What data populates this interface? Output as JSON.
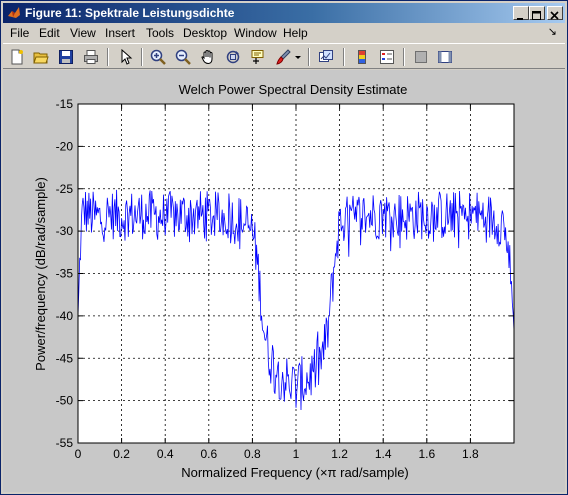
{
  "window": {
    "title": "Figure 11: Spektrale Leistungsdichte",
    "controls": [
      "minimize",
      "maximize",
      "close"
    ]
  },
  "menu": {
    "items": [
      "File",
      "Edit",
      "View",
      "Insert",
      "Tools",
      "Desktop",
      "Window",
      "Help"
    ],
    "dock_arrow": "↘"
  },
  "toolbar": {
    "buttons": [
      "new-figure",
      "open-file",
      "save",
      "print",
      "edit-plot",
      "zoom-in",
      "zoom-out",
      "pan",
      "rotate-3d",
      "data-cursor",
      "brush",
      "link-plot",
      "insert-colorbar",
      "insert-legend",
      "hide-plot-tools",
      "show-plot-tools"
    ]
  },
  "colors": {
    "line": "#0000ff",
    "plot_background": "#ffffff",
    "figure_background": "#c8c8c8"
  },
  "chart_data": {
    "type": "line",
    "title": "Welch Power Spectral Density Estimate",
    "xlabel": "Normalized Frequency  (×π rad/sample)",
    "ylabel": "Power/frequency (dB/rad/sample)",
    "xlim": [
      0,
      2
    ],
    "ylim": [
      -55,
      -15
    ],
    "xticks": [
      0,
      0.2,
      0.4,
      0.6,
      0.8,
      1,
      1.2,
      1.4,
      1.6,
      1.8
    ],
    "xtick_labels": [
      "0",
      "0.2",
      "0.4",
      "0.6",
      "0.8",
      "1",
      "1.2",
      "1.4",
      "1.6",
      "1.8"
    ],
    "yticks": [
      -15,
      -20,
      -25,
      -30,
      -35,
      -40,
      -45,
      -50,
      -55
    ],
    "ytick_labels": [
      "-15",
      "-20",
      "-25",
      "-30",
      "-35",
      "-40",
      "-45",
      "-50",
      "-55"
    ],
    "grid": true,
    "grid_style": "dotted",
    "series": [
      {
        "color": "#0000ff",
        "x": [
          0,
          0.005,
          0.01,
          0.02,
          0.03,
          0.05,
          0.1,
          0.15,
          0.2,
          0.3,
          0.4,
          0.5,
          0.6,
          0.7,
          0.75,
          0.8,
          0.82,
          0.84,
          0.85,
          0.87,
          0.9,
          0.95,
          1.0,
          1.05,
          1.1,
          1.13,
          1.15,
          1.16,
          1.18,
          1.2,
          1.3,
          1.4,
          1.5,
          1.6,
          1.7,
          1.8,
          1.9,
          1.95,
          1.97,
          1.98,
          1.99,
          2.0
        ],
        "y": [
          -41,
          -37,
          -32,
          -28,
          -27.5,
          -28,
          -28.5,
          -28,
          -28.2,
          -28,
          -28.3,
          -28,
          -28.2,
          -28.5,
          -28.8,
          -30,
          -33,
          -38,
          -41,
          -44,
          -46,
          -47.5,
          -48.5,
          -47.5,
          -46,
          -44,
          -41,
          -38,
          -33,
          -29,
          -28.2,
          -28,
          -28.3,
          -28,
          -28.2,
          -28,
          -28.5,
          -29,
          -31,
          -34,
          -38,
          -41
        ]
      }
    ]
  }
}
